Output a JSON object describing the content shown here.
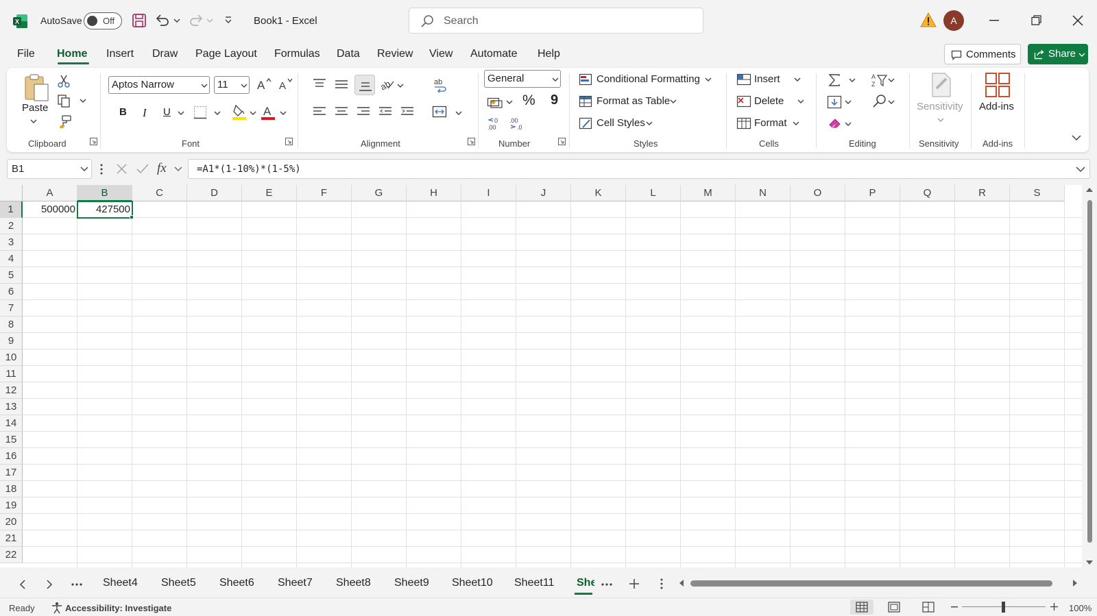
{
  "titlebar": {
    "autosave_label": "AutoSave",
    "autosave_state": "Off",
    "doc_title": "Book1  -  Excel",
    "search_placeholder": "Search",
    "avatar_initial": "A"
  },
  "menu": {
    "tabs": [
      "File",
      "Home",
      "Insert",
      "Draw",
      "Page Layout",
      "Formulas",
      "Data",
      "Review",
      "View",
      "Automate",
      "Help"
    ],
    "active": "Home",
    "comments_label": "Comments",
    "share_label": "Share"
  },
  "ribbon": {
    "clipboard": {
      "paste_label": "Paste",
      "group_label": "Clipboard"
    },
    "font": {
      "font_name": "Aptos Narrow",
      "font_size": "11",
      "group_label": "Font",
      "bold": "B",
      "italic": "I",
      "underline": "U"
    },
    "alignment": {
      "group_label": "Alignment"
    },
    "number": {
      "format": "General",
      "group_label": "Number",
      "percent": "%",
      "comma": "9"
    },
    "styles": {
      "conditional_formatting": "Conditional Formatting",
      "format_as_table": "Format as Table",
      "cell_styles": "Cell Styles",
      "group_label": "Styles"
    },
    "cells": {
      "insert": "Insert",
      "delete": "Delete",
      "format": "Format",
      "group_label": "Cells"
    },
    "editing": {
      "group_label": "Editing"
    },
    "sensitivity": {
      "label": "Sensitivity",
      "group_label": "Sensitivity"
    },
    "addins": {
      "label": "Add-ins",
      "group_label": "Add-ins"
    }
  },
  "formula_bar": {
    "name_box": "B1",
    "fx": "fx",
    "formula": "=A1*(1-10%)*(1-5%)"
  },
  "grid": {
    "columns": [
      "A",
      "B",
      "C",
      "D",
      "E",
      "F",
      "G",
      "H",
      "I",
      "J",
      "K",
      "L",
      "M",
      "N",
      "O",
      "P",
      "Q",
      "R",
      "S"
    ],
    "rows": [
      "1",
      "2",
      "3",
      "4",
      "5",
      "6",
      "7",
      "8",
      "9",
      "10",
      "11",
      "12",
      "13",
      "14",
      "15",
      "16",
      "17",
      "18",
      "19",
      "20",
      "21",
      "22"
    ],
    "selected_cell": "B1",
    "cells": {
      "A1": "500000",
      "B1": "427500"
    }
  },
  "sheets": {
    "tabs": [
      "Sheet4",
      "Sheet5",
      "Sheet6",
      "Sheet7",
      "Sheet8",
      "Sheet9",
      "Sheet10",
      "Sheet11",
      "She"
    ],
    "active": "She"
  },
  "status": {
    "ready": "Ready",
    "accessibility": "Accessibility: Investigate",
    "zoom": "100%"
  },
  "colors": {
    "excel_green": "#107c41",
    "warning": "#e8a317",
    "avatar_bg": "#8a3a2a"
  }
}
